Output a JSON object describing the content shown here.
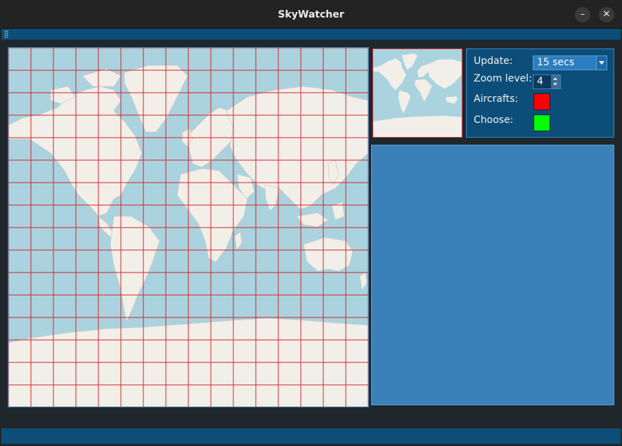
{
  "window": {
    "title": "SkyWatcher",
    "minimize_label": "–",
    "close_label": "✕"
  },
  "controls": {
    "update_label": "Update:",
    "update_value": "15 secs",
    "zoom_label": "Zoom level:",
    "zoom_value": "4",
    "aircrafts_label": "Aircrafts:",
    "aircrafts_color": "#ff0000",
    "choose_label": "Choose:",
    "choose_color": "#00ff00"
  },
  "map": {
    "grid_color": "#d2232a",
    "ocean_color": "#aad3df",
    "land_color": "#f2efe9"
  }
}
